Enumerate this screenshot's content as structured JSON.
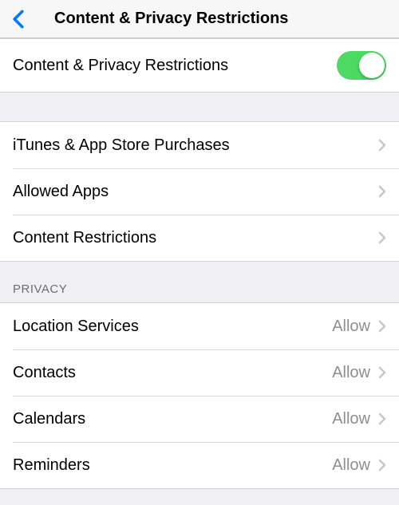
{
  "nav": {
    "title": "Content & Privacy Restrictions"
  },
  "mainToggle": {
    "label": "Content & Privacy Restrictions",
    "state": "on"
  },
  "group1": {
    "items": [
      {
        "label": "iTunes & App Store Purchases"
      },
      {
        "label": "Allowed Apps"
      },
      {
        "label": "Content Restrictions"
      }
    ]
  },
  "privacy": {
    "header": "Privacy",
    "items": [
      {
        "label": "Location Services",
        "value": "Allow"
      },
      {
        "label": "Contacts",
        "value": "Allow"
      },
      {
        "label": "Calendars",
        "value": "Allow"
      },
      {
        "label": "Reminders",
        "value": "Allow"
      }
    ]
  },
  "colors": {
    "toggleOn": "#4cd964",
    "chevron": "#c7c7cc",
    "backChevron": "#007aff"
  }
}
